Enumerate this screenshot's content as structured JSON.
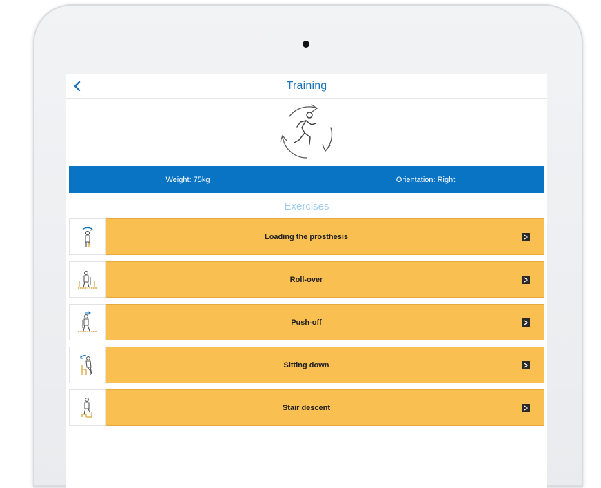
{
  "header": {
    "title": "Training",
    "back_icon": "chevron-left-icon"
  },
  "hero": {
    "icon": "running-cycle-icon"
  },
  "info": {
    "weight": "Weight: 75kg",
    "orientation": "Orientation: Right",
    "background": "#0a74c4"
  },
  "exercises": {
    "title": "Exercises",
    "items": [
      {
        "label": "Loading the prosthesis",
        "icon": "standing-figure-icon"
      },
      {
        "label": "Roll-over",
        "icon": "rollover-figure-icon"
      },
      {
        "label": "Push-off",
        "icon": "pushoff-figure-icon"
      },
      {
        "label": "Sitting down",
        "icon": "sitting-figure-icon"
      },
      {
        "label": "Stair descent",
        "icon": "stair-figure-icon"
      }
    ],
    "row_color": "#f9bf50"
  }
}
